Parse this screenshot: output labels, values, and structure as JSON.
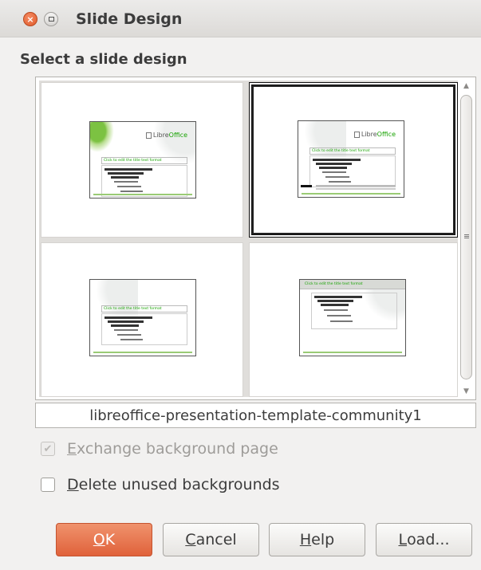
{
  "window": {
    "title": "Slide Design",
    "close_glyph": "×"
  },
  "main": {
    "heading": "Select a slide design",
    "selected_template_name": "libreoffice-presentation-template-community1",
    "thumbnails": [
      {
        "title_text": "Click to edit the title text format",
        "logo": "LibreOffice",
        "logo_brand": "Libre",
        "logo_suffix": "Office",
        "selected": false
      },
      {
        "title_text": "Click to edit the title text format",
        "logo": "LibreOffice",
        "logo_brand": "Libre",
        "logo_suffix": "Office",
        "selected": true
      },
      {
        "title_text": "Click to edit the title text format",
        "selected": false
      },
      {
        "title_text": "Click to edit the title text format",
        "selected": false
      }
    ]
  },
  "options": {
    "exchange_background": {
      "prefix": "E",
      "rest": "xchange background page",
      "checked": true,
      "enabled": false
    },
    "delete_unused": {
      "prefix": "D",
      "rest": "elete unused backgrounds",
      "checked": false,
      "enabled": true
    }
  },
  "buttons": {
    "ok": {
      "prefix": "O",
      "rest": "K"
    },
    "cancel": {
      "prefix": "C",
      "rest": "ancel"
    },
    "help": {
      "prefix": "H",
      "rest": "elp"
    },
    "load": {
      "prefix": "L",
      "rest": "oad..."
    }
  },
  "colors": {
    "accent": "#e0623b",
    "brand_green": "#18a303"
  },
  "icons": {
    "close": "close-icon",
    "maximize": "maximize-icon",
    "scroll_up": "chevron-up-icon",
    "scroll_down": "chevron-down-icon",
    "checkmark": "check-icon"
  }
}
